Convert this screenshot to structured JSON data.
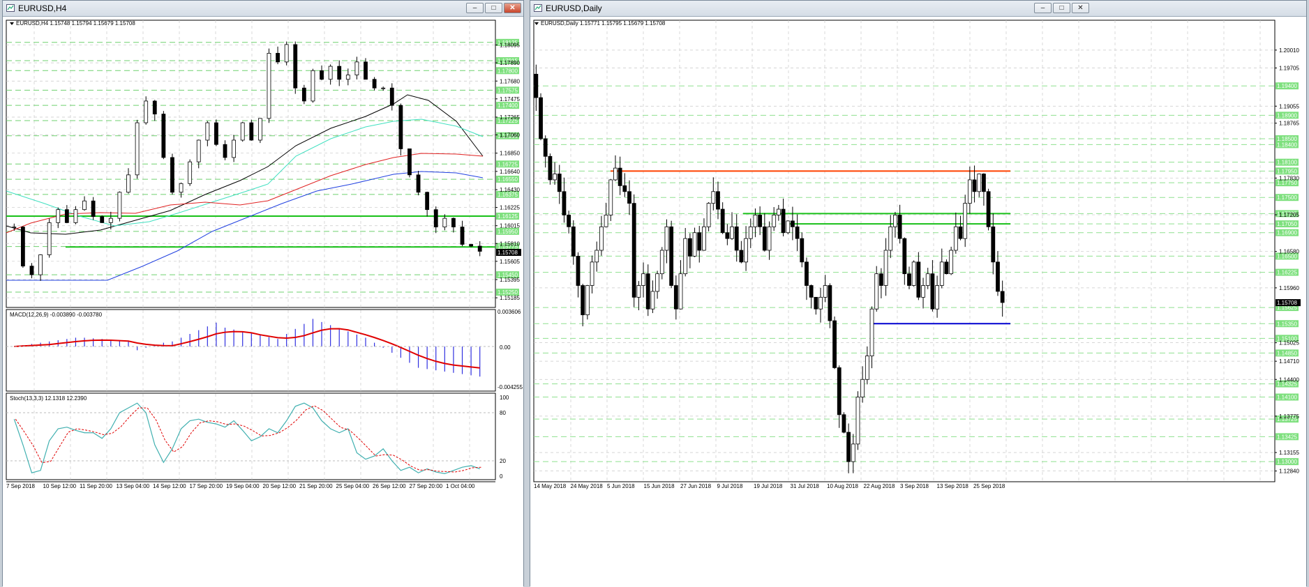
{
  "left_window": {
    "title": "EURUSD,H4",
    "header": "EURUSD,H4  1.15748 1.15794 1.15679 1.15708",
    "price_labels": [
      "1.18095",
      "1.17890",
      "1.17680",
      "1.17475",
      "1.17265",
      "1.17060",
      "1.16850",
      "1.16640",
      "1.16430",
      "1.16225",
      "1.16015",
      "1.15810",
      "1.15605",
      "1.15395",
      "1.15185"
    ],
    "green_labels": [
      "1.18125",
      "1.17915",
      "1.17800",
      "1.17575",
      "1.17400",
      "1.17225",
      "1.17050",
      "1.16725",
      "1.16550",
      "1.16375",
      "1.16125",
      "1.15950",
      "1.15775",
      "1.15450",
      "1.15250"
    ],
    "current_price": "1.15708",
    "macd_header": "MACD(12,26,9) -0.003890 -0.003780",
    "macd_scale": [
      "0.003606",
      "0.00",
      "-0.004255"
    ],
    "stoch_header": "Stoch(13,3,3) 12.1318 12.2390",
    "stoch_scale": [
      "100",
      "80",
      "20",
      "0"
    ],
    "time_labels": [
      "7 Sep 2018",
      "10 Sep 12:00",
      "11 Sep 20:00",
      "13 Sep 04:00",
      "14 Sep 12:00",
      "17 Sep 20:00",
      "19 Sep 04:00",
      "20 Sep 12:00",
      "21 Sep 20:00",
      "25 Sep 04:00",
      "26 Sep 12:00",
      "27 Sep 20:00",
      "1 Oct 04:00"
    ]
  },
  "right_window": {
    "title": "EURUSD,Daily",
    "header": "EURUSD,Daily  1.15771 1.15795 1.15679 1.15708",
    "price_labels": [
      "1.20010",
      "1.19705",
      "1.19055",
      "1.18765",
      "1.17830",
      "1.17205",
      "1.16580",
      "1.15960",
      "1.15025",
      "1.14710",
      "1.14400",
      "1.13775",
      "1.13155",
      "1.12840"
    ],
    "green_labels": [
      "1.19400",
      "1.18900",
      "1.18500",
      "1.18400",
      "1.18100",
      "1.17950",
      "1.17750",
      "1.17500",
      "1.17225",
      "1.17050",
      "1.16900",
      "1.16500",
      "1.16225",
      "1.15625",
      "1.15350",
      "1.15100",
      "1.14850",
      "1.14325",
      "1.14100",
      "1.13725",
      "1.13425",
      "1.13000"
    ],
    "current_price": "1.15708",
    "time_labels": [
      "14 May 2018",
      "24 May 2018",
      "5 Jun 2018",
      "15 Jun 2018",
      "27 Jun 2018",
      "9 Jul 2018",
      "19 Jul 2018",
      "31 Jul 2018",
      "10 Aug 2018",
      "22 Aug 2018",
      "3 Sep 2018",
      "13 Sep 2018",
      "25 Sep 2018"
    ]
  },
  "window_buttons": {
    "minimize": "–",
    "maximize": "□",
    "close": "✕"
  },
  "colors": {
    "up_candle": "#ffffff",
    "down_candle": "#000000",
    "green_level": "#22c022",
    "resistance": "#ff4000",
    "support": "#0000d0",
    "ma_black": "#000000",
    "ma_teal": "#40e0c0",
    "ma_red": "#e02020",
    "ma_blue": "#2040e0",
    "macd_hist": "#3030e0",
    "macd_signal": "#e00000",
    "stoch_main": "#40b0b0",
    "stoch_signal": "#e00000"
  }
}
